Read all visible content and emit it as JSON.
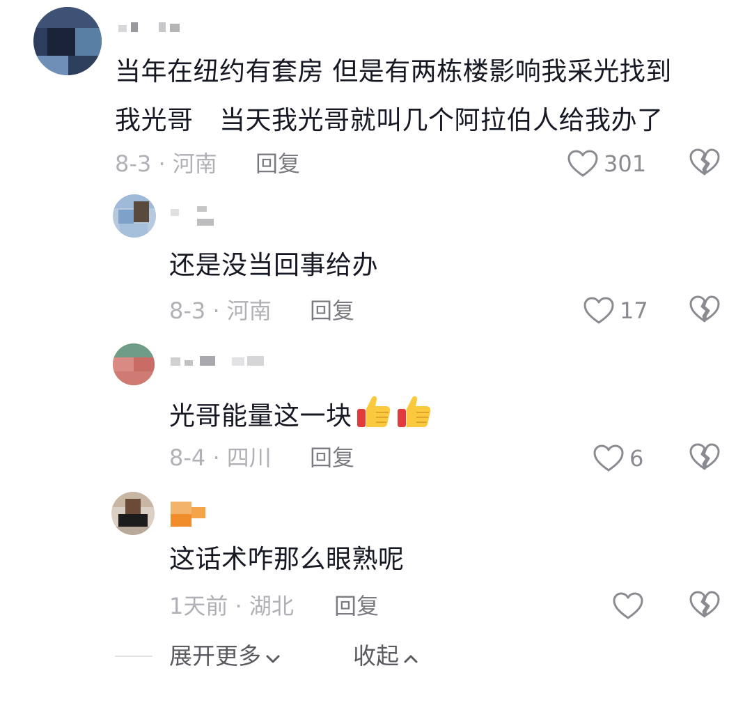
{
  "comments": [
    {
      "text_line1": "当年在纽约有套房 但是有两栋楼影响我采光找到",
      "text_line2": "我光哥　当天我光哥就叫几个阿拉伯人给我办了",
      "meta": "8-3 · 河南",
      "reply_label": "回复",
      "likes": "301"
    },
    {
      "text": "还是没当回事给办",
      "meta": "8-3 · 河南",
      "reply_label": "回复",
      "likes": "17"
    },
    {
      "text": "光哥能量这一块",
      "emoji": [
        "thumbs-up",
        "thumbs-up"
      ],
      "meta": "8-4 · 四川",
      "reply_label": "回复",
      "likes": "6"
    },
    {
      "text": "这话术咋那么眼熟呢",
      "meta": "1天前 · 湖北",
      "reply_label": "回复",
      "likes": ""
    }
  ],
  "footer": {
    "expand_label": "展开更多",
    "collapse_label": "收起"
  },
  "icons": {
    "like": "heart-outline-icon",
    "dislike": "broken-heart-icon",
    "expand": "chevron-down-icon",
    "collapse": "chevron-up-icon"
  },
  "colors": {
    "text": "#161823",
    "meta": "#b0b1b6",
    "reply": "#7a7b80"
  }
}
